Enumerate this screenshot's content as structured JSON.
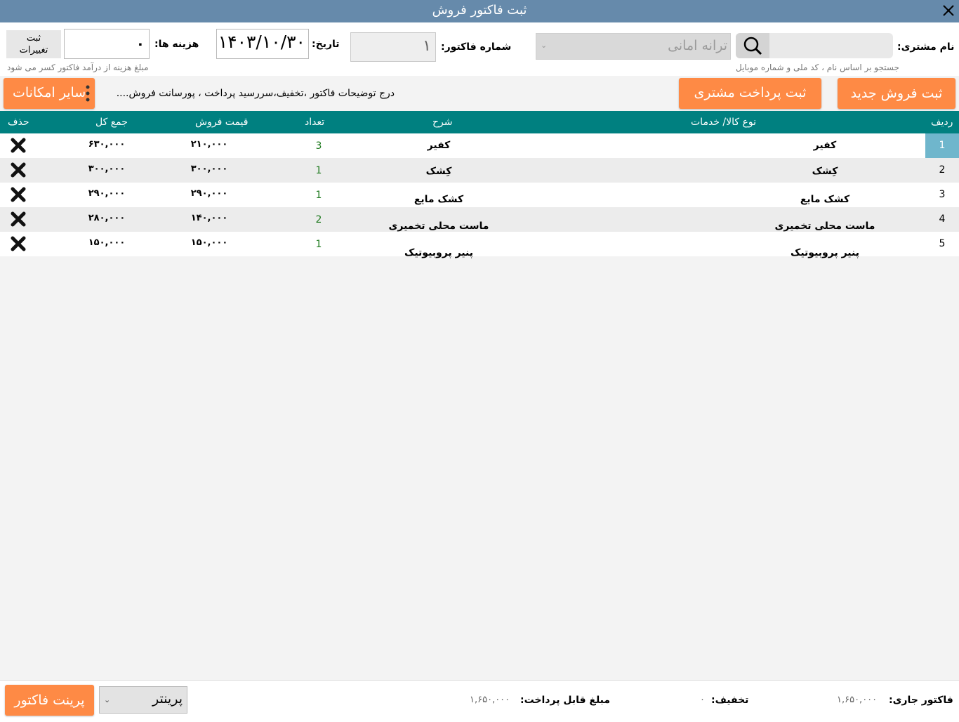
{
  "window": {
    "title": "ثبت فاکتور فروش"
  },
  "customer": {
    "label": "نام مشتری:",
    "search_value": "",
    "hint": "جستجو بر اساس نام ، کد ملی و شماره موبایل",
    "selected": "ترانه امانی"
  },
  "invoice": {
    "number_label": "شماره فاکتور:",
    "number": "۱"
  },
  "date": {
    "label": "تاریخ:",
    "value": "۱۴۰۳/۱۰/۳۰"
  },
  "cost": {
    "label": "هزینه ها:",
    "value": "۰",
    "hint": "مبلغ هزینه از درآمد فاکتور کسر می شود"
  },
  "save_changes": {
    "line1": "ثبت",
    "line2": "تغییرات"
  },
  "actions": {
    "new_sale": "ثبت فروش جدید",
    "customer_payment": "ثبت پرداخت مشتری",
    "more_options": "سایر امکانات",
    "description_link": "درج توضیحات فاکتور ،تخفیف،سررسید پرداخت ، پورسانت فروش...."
  },
  "table": {
    "headers": {
      "row": "ردیف",
      "type": "نوع کالا/ خدمات",
      "desc": "شرح",
      "qty": "تعداد",
      "price": "قیمت فروش",
      "total": "جمع کل",
      "delete": "حذف"
    },
    "rows": [
      {
        "num": "1",
        "type": "کفیر",
        "desc": "کفیر",
        "qty": "3",
        "price": "۲۱۰,۰۰۰",
        "total": "۶۳۰,۰۰۰"
      },
      {
        "num": "2",
        "type": "کِشک",
        "desc": "کِشک",
        "qty": "1",
        "price": "۳۰۰,۰۰۰",
        "total": "۳۰۰,۰۰۰"
      },
      {
        "num": "3",
        "type": "کشک مایع",
        "desc": "کشک مایع",
        "qty": "1",
        "price": "۲۹۰,۰۰۰",
        "total": "۲۹۰,۰۰۰"
      },
      {
        "num": "4",
        "type": "ماست محلی تخمیری",
        "desc": "ماست محلی تخمیری",
        "qty": "2",
        "price": "۱۴۰,۰۰۰",
        "total": "۲۸۰,۰۰۰"
      },
      {
        "num": "5",
        "type": "پنیر پروبیوتیک",
        "desc": "پنیر پروبیوتیک",
        "qty": "1",
        "price": "۱۵۰,۰۰۰",
        "total": "۱۵۰,۰۰۰"
      }
    ]
  },
  "footer": {
    "current_label": "فاکتور جاری:",
    "current_value": "۱,۶۵۰,۰۰۰",
    "discount_label": "تخفیف:",
    "discount_value": "۰",
    "payable_label": "مبلغ قابل پرداخت:",
    "payable_value": "۱,۶۵۰,۰۰۰",
    "printer": "پرینتر",
    "print_invoice": "پرینت فاکتور"
  },
  "colors": {
    "titlebar": "#668aab",
    "table_header": "#008080",
    "accent_orange": "#fe8a45",
    "selected_row_cell": "#6fb6cc",
    "quantity_text": "#1f7a1f"
  }
}
